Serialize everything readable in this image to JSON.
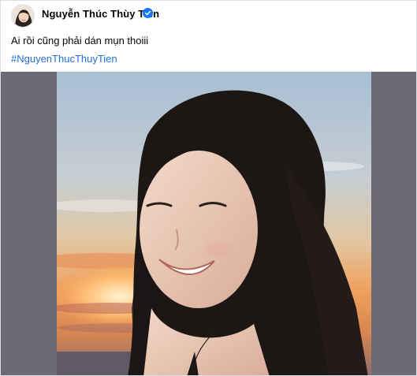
{
  "post": {
    "author": {
      "name": "Nguyễn Thúc Thùy Tiên",
      "verified": true,
      "avatar_icon": "profile-photo",
      "verified_icon": "verified-badge-icon"
    },
    "caption": "Ai rồi cũng phải dán mụn thoiii",
    "hashtag": "#NguyenThucThuyTien",
    "photo_description": "photo-of-woman-smiling-at-sunset",
    "more_icon": "ellipsis-icon"
  },
  "colors": {
    "name": "#050505",
    "text": "#050505",
    "hashtag": "#216fdb",
    "verified": "#1877f2",
    "media_backdrop": "#6d6a76"
  }
}
